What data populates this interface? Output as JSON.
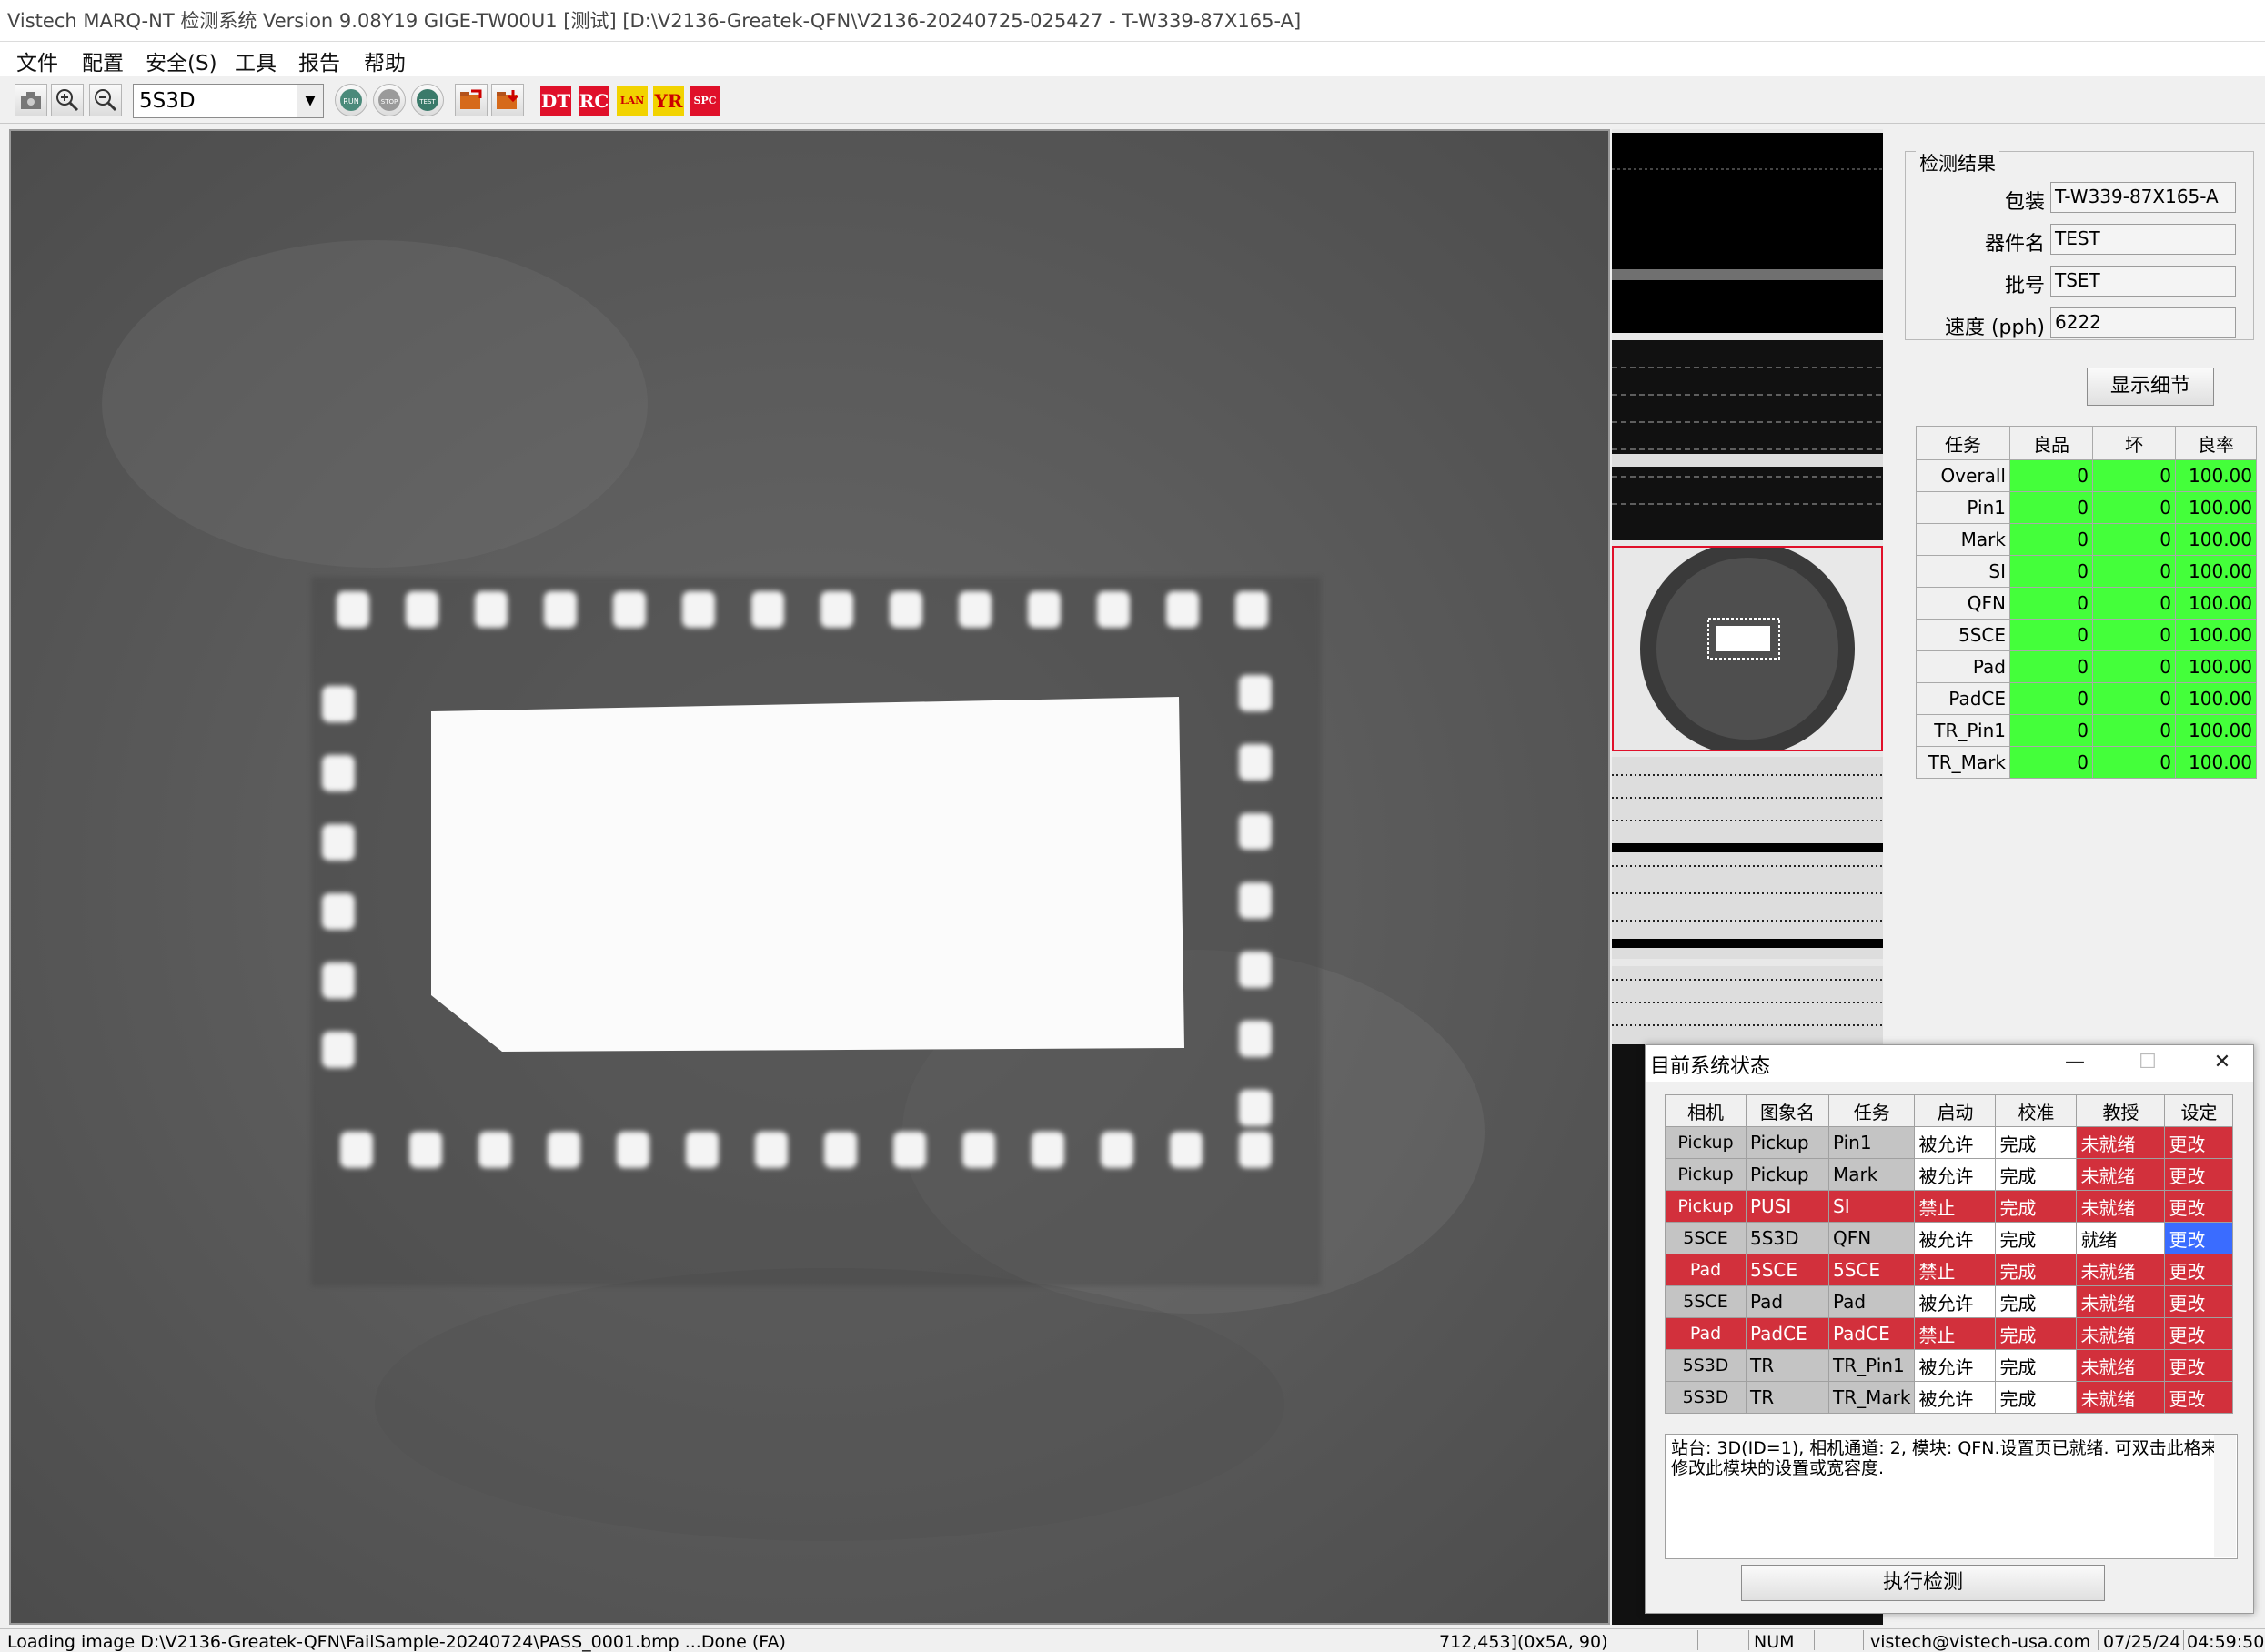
{
  "window": {
    "title": "Vistech MARQ-NT 检测系统 Version 9.08Y19 GIGE-TW00U1 [测试] [D:\\V2136-Greatek-QFN\\V2136-20240725-025427 - T-W339-87X165-A]"
  },
  "menu": [
    "文件",
    "配置",
    "安全(S)",
    "工具",
    "报告",
    "帮助"
  ],
  "toolbar": {
    "model_select": "5S3D",
    "badges": [
      "DT",
      "RC",
      "LAN",
      "YR",
      "SPC"
    ],
    "colors": {
      "badge_red": "#e0102a",
      "badge_yellow": "#f2d300"
    }
  },
  "result": {
    "group_title": "检测结果",
    "fields": [
      {
        "label": "包装",
        "value": "T-W339-87X165-A"
      },
      {
        "label": "器件名",
        "value": "TEST"
      },
      {
        "label": "批号",
        "value": "TSET"
      },
      {
        "label": "速度 (pph)",
        "value": "6222"
      }
    ],
    "detail_button": "显示细节"
  },
  "stats": {
    "headers": [
      "任务",
      "良品",
      "坏",
      "良率"
    ],
    "rows": [
      [
        "Overall",
        "0",
        "0",
        "100.00"
      ],
      [
        "Pin1",
        "0",
        "0",
        "100.00"
      ],
      [
        "Mark",
        "0",
        "0",
        "100.00"
      ],
      [
        "SI",
        "0",
        "0",
        "100.00"
      ],
      [
        "QFN",
        "0",
        "0",
        "100.00"
      ],
      [
        "5SCE",
        "0",
        "0",
        "100.00"
      ],
      [
        "Pad",
        "0",
        "0",
        "100.00"
      ],
      [
        "PadCE",
        "0",
        "0",
        "100.00"
      ],
      [
        "TR_Pin1",
        "0",
        "0",
        "100.00"
      ],
      [
        "TR_Mark",
        "0",
        "0",
        "100.00"
      ]
    ],
    "color_good": "#44ff3a"
  },
  "status_window": {
    "title": "目前系统状态",
    "controls": [
      "—",
      "☐",
      "✕"
    ],
    "headers": [
      "相机",
      "图象名",
      "任务",
      "启动",
      "校准",
      "教授",
      "设定"
    ],
    "rows": [
      {
        "cells": [
          "Pickup",
          "Pickup",
          "Pin1",
          "被允许",
          "完成",
          "未就绪",
          "更改"
        ],
        "colors": [
          "grey",
          "grey",
          "grey",
          "white",
          "white",
          "red",
          "red"
        ]
      },
      {
        "cells": [
          "Pickup",
          "Pickup",
          "Mark",
          "被允许",
          "完成",
          "未就绪",
          "更改"
        ],
        "colors": [
          "grey",
          "grey",
          "grey",
          "white",
          "white",
          "red",
          "red"
        ]
      },
      {
        "cells": [
          "Pickup",
          "PUSI",
          "SI",
          "禁止",
          "完成",
          "未就绪",
          "更改"
        ],
        "colors": [
          "red",
          "red",
          "red",
          "red",
          "red",
          "red",
          "red"
        ]
      },
      {
        "cells": [
          "5SCE",
          "5S3D",
          "QFN",
          "被允许",
          "完成",
          "就绪",
          "更改"
        ],
        "colors": [
          "grey",
          "grey",
          "grey",
          "white",
          "white",
          "white",
          "blue"
        ]
      },
      {
        "cells": [
          "Pad",
          "5SCE",
          "5SCE",
          "禁止",
          "完成",
          "未就绪",
          "更改"
        ],
        "colors": [
          "red",
          "red",
          "red",
          "red",
          "red",
          "red",
          "red"
        ]
      },
      {
        "cells": [
          "5SCE",
          "Pad",
          "Pad",
          "被允许",
          "完成",
          "未就绪",
          "更改"
        ],
        "colors": [
          "grey",
          "grey",
          "grey",
          "white",
          "white",
          "red",
          "red"
        ]
      },
      {
        "cells": [
          "Pad",
          "PadCE",
          "PadCE",
          "禁止",
          "完成",
          "未就绪",
          "更改"
        ],
        "colors": [
          "red",
          "red",
          "red",
          "red",
          "red",
          "red",
          "red"
        ]
      },
      {
        "cells": [
          "5S3D",
          "TR",
          "TR_Pin1",
          "被允许",
          "完成",
          "未就绪",
          "更改"
        ],
        "colors": [
          "grey",
          "grey",
          "grey",
          "white",
          "white",
          "red",
          "red"
        ]
      },
      {
        "cells": [
          "5S3D",
          "TR",
          "TR_Mark",
          "被允许",
          "完成",
          "未就绪",
          "更改"
        ],
        "colors": [
          "grey",
          "grey",
          "grey",
          "white",
          "white",
          "red",
          "red"
        ]
      }
    ],
    "message": "站台: 3D(ID=1), 相机通道: 2, 模块: QFN.设置页已就绪. 可双击此格来修改此模块的设置或宽容度.",
    "run_button": "执行检测"
  },
  "statusbar": {
    "loading": "Loading image D:\\V2136-Greatek-QFN\\FailSample-20240724\\PASS_0001.bmp ...Done (FA)",
    "coords": "712,453](0x5A, 90)",
    "num": "NUM",
    "email": "vistech@vistech-usa.com",
    "date": "07/25/24",
    "time": "04:59:50"
  }
}
